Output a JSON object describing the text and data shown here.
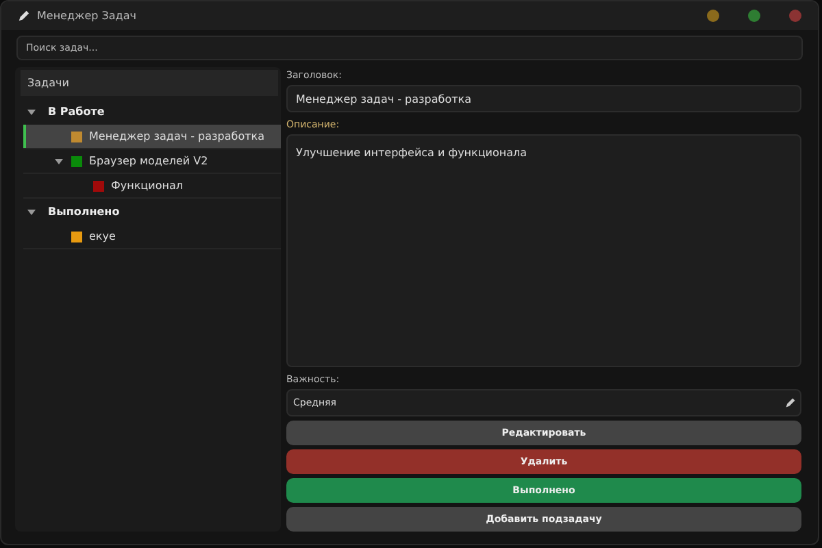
{
  "window": {
    "title": "Менеджер Задач",
    "controls": [
      {
        "color": "#8a6a1c"
      },
      {
        "color": "#2e7d32"
      },
      {
        "color": "#8b3333"
      }
    ]
  },
  "search": {
    "placeholder": "Поиск задач..."
  },
  "tree": {
    "header": "Задачи",
    "groups": [
      {
        "label": "В Работе",
        "expanded": true,
        "children": [
          {
            "label": "Менеджер задач - разработка",
            "color": "#c08a30",
            "selected": true
          },
          {
            "label": "Браузер моделей V2",
            "color": "#0a8a0a",
            "selected": false,
            "expanded": true,
            "children": [
              {
                "label": "Функционал",
                "color": "#a00a0a",
                "selected": false
              }
            ]
          }
        ]
      },
      {
        "label": "Выполнено",
        "expanded": true,
        "children": [
          {
            "label": "екуе",
            "color": "#e89a10",
            "selected": false
          }
        ]
      }
    ]
  },
  "details": {
    "title_label": "Заголовок:",
    "title_value": "Менеджер задач - разработка",
    "description_label": "Описание:",
    "description_value": "Улучшение интерфейса и функционала",
    "priority_label": "Важность:",
    "priority_value": "Средняя"
  },
  "buttons": [
    {
      "label": "Редактировать",
      "kind": "neutral"
    },
    {
      "label": "Удалить",
      "kind": "danger"
    },
    {
      "label": "Выполнено",
      "kind": "success"
    },
    {
      "label": "Добавить подзадачу",
      "kind": "neutral"
    }
  ]
}
